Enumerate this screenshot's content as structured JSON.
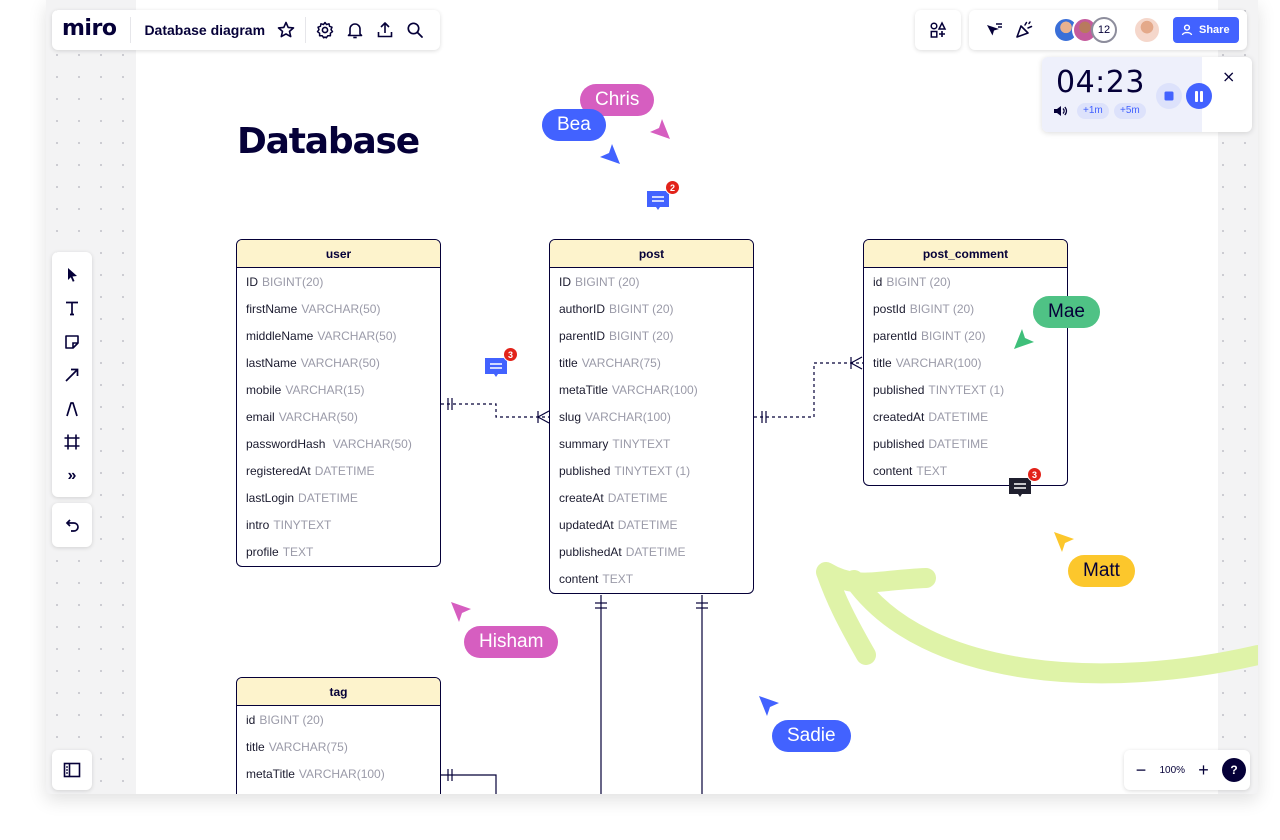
{
  "app": {
    "logo": "miro",
    "board_title": "Database diagram",
    "heading": "Database"
  },
  "topbar": {
    "icons": [
      "star-icon",
      "gear-icon",
      "bell-icon",
      "upload-icon",
      "search-icon"
    ],
    "share_label": "Share",
    "collaborator_count": "12"
  },
  "timer": {
    "time": "04:23",
    "add_one": "+1m",
    "add_five": "+5m",
    "close": "×"
  },
  "toolbar": {
    "tools": [
      "select-icon",
      "text-icon",
      "sticky-note-icon",
      "arrow-icon",
      "pen-icon",
      "frame-icon",
      "more-icon"
    ],
    "more": "»"
  },
  "zoom": {
    "minus": "−",
    "level": "100%",
    "plus": "+",
    "help": "?"
  },
  "tables": {
    "user": {
      "name": "user",
      "rows": [
        {
          "name": "ID",
          "type": "BIGINT(20)"
        },
        {
          "name": "firstName",
          "type": "VARCHAR(50)"
        },
        {
          "name": "middleName",
          "type": "VARCHAR(50)"
        },
        {
          "name": "lastName",
          "type": "VARCHAR(50)"
        },
        {
          "name": "mobile",
          "type": "VARCHAR(15)"
        },
        {
          "name": "email",
          "type": "VARCHAR(50)"
        },
        {
          "name": "passwordHash",
          "type": " VARCHAR(50)"
        },
        {
          "name": "registeredAt",
          "type": "DATETIME"
        },
        {
          "name": "lastLogin",
          "type": "DATETIME"
        },
        {
          "name": "intro",
          "type": "TINYTEXT"
        },
        {
          "name": "profile",
          "type": "TEXT"
        }
      ]
    },
    "post": {
      "name": "post",
      "rows": [
        {
          "name": "ID",
          "type": "BIGINT (20)"
        },
        {
          "name": "authorID",
          "type": "BIGINT (20)"
        },
        {
          "name": "parentID",
          "type": "BIGINT (20)"
        },
        {
          "name": "title",
          "type": "VARCHAR(75)"
        },
        {
          "name": "metaTitle",
          "type": "VARCHAR(100)"
        },
        {
          "name": "slug",
          "type": "VARCHAR(100)"
        },
        {
          "name": "summary",
          "type": "TINYTEXT"
        },
        {
          "name": "published",
          "type": "TINYTEXT (1)"
        },
        {
          "name": "createAt",
          "type": "DATETIME"
        },
        {
          "name": "updatedAt",
          "type": "DATETIME"
        },
        {
          "name": "publishedAt",
          "type": "DATETIME"
        },
        {
          "name": "content",
          "type": "TEXT"
        }
      ]
    },
    "post_comment": {
      "name": "post_comment",
      "rows": [
        {
          "name": "id",
          "type": "BIGINT (20)"
        },
        {
          "name": "postId",
          "type": "BIGINT (20)"
        },
        {
          "name": "parentId",
          "type": "BIGINT (20)"
        },
        {
          "name": "title",
          "type": "VARCHAR(100)"
        },
        {
          "name": "published",
          "type": "TINYTEXT (1)"
        },
        {
          "name": "createdAt",
          "type": "DATETIME"
        },
        {
          "name": "published",
          "type": "DATETIME"
        },
        {
          "name": "content",
          "type": "TEXT"
        }
      ]
    },
    "tag": {
      "name": "tag",
      "rows": [
        {
          "name": "id",
          "type": "BIGINT (20)"
        },
        {
          "name": "title",
          "type": "VARCHAR(75)"
        },
        {
          "name": "metaTitle",
          "type": "VARCHAR(100)"
        }
      ]
    }
  },
  "cursors": [
    {
      "name": "Chris",
      "color": "#d65ec0"
    },
    {
      "name": "Bea",
      "color": "#4262ff"
    },
    {
      "name": "Mae",
      "color": "#3fbf7a"
    },
    {
      "name": "Hisham",
      "color": "#d65ec0"
    },
    {
      "name": "Matt",
      "color": "#fcc72c"
    },
    {
      "name": "Sadie",
      "color": "#4262ff"
    }
  ],
  "comments": [
    {
      "count": "2",
      "color": "#4262ff"
    },
    {
      "count": "3",
      "color": "#4262ff"
    },
    {
      "count": "3",
      "color": "#1f1f2e"
    }
  ],
  "colors": {
    "ink": "#050038",
    "accent": "#4262ff",
    "table_header": "#fdf3cc",
    "arrow_sketch": "#d9f0a0"
  }
}
